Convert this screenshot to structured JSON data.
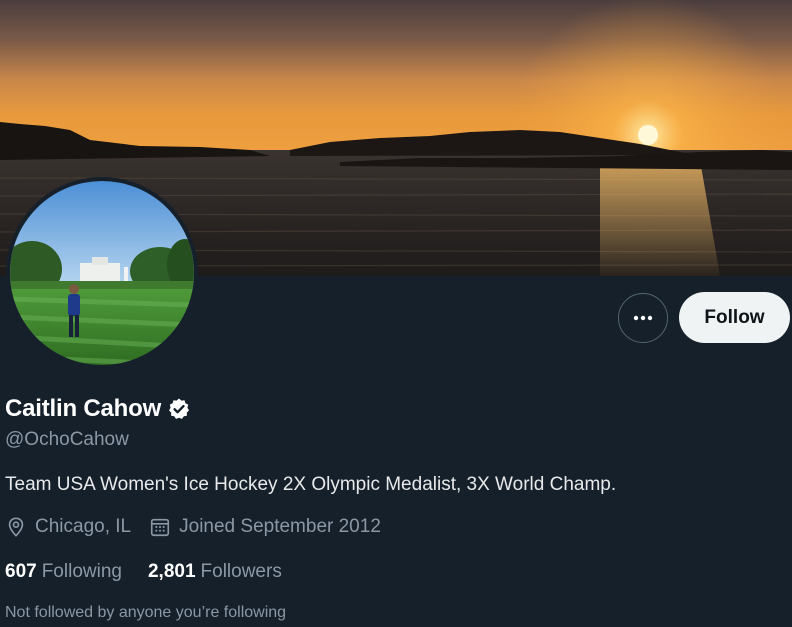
{
  "profile": {
    "display_name": "Caitlin Cahow",
    "handle": "@OchoCahow",
    "bio": "Team USA Women's Ice Hockey 2X Olympic Medalist, 3X World Champ.",
    "location": "Chicago, IL",
    "joined": "Joined September 2012",
    "verified": true
  },
  "actions": {
    "follow_label": "Follow",
    "more_icon": "ellipsis-icon"
  },
  "stats": {
    "following_count": "607",
    "following_label": "Following",
    "followers_count": "2,801",
    "followers_label": "Followers"
  },
  "social_context": "Not followed by anyone you’re following",
  "colors": {
    "background": "#15202b",
    "secondary_text": "#8b98a5",
    "follow_button_bg": "#eff3f4"
  }
}
